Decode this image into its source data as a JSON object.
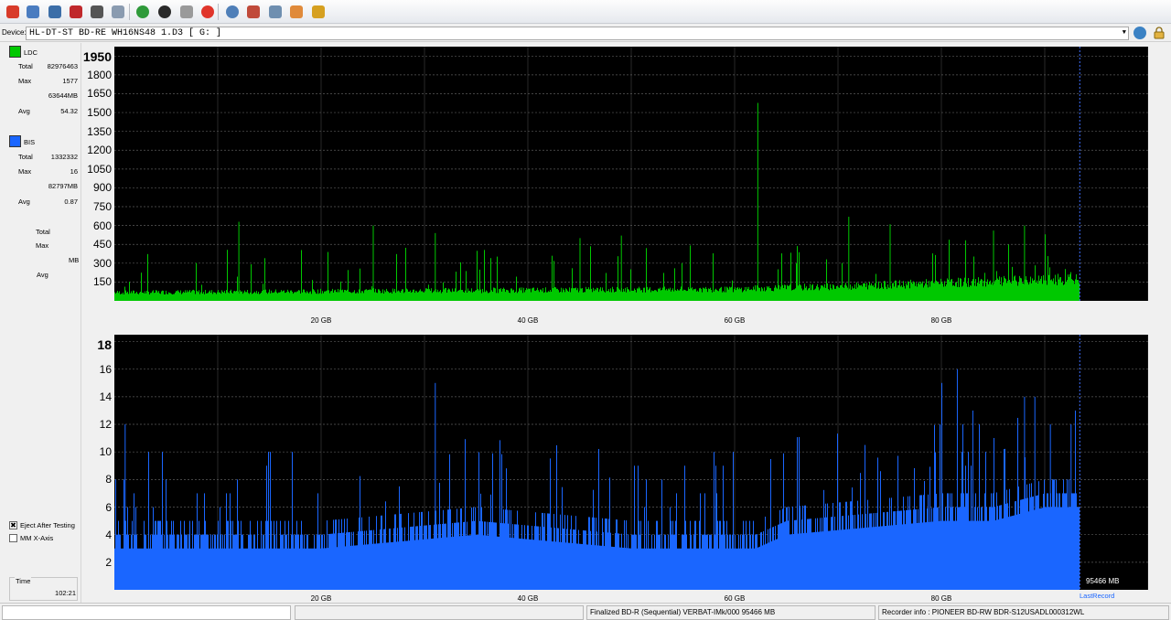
{
  "toolbar": {
    "buttons": [
      {
        "name": "power-button",
        "icon": "power-icon",
        "color": "#d83b2a"
      },
      {
        "name": "wizard-button",
        "icon": "wand-icon",
        "color": "#4a7cc0"
      },
      {
        "name": "scan-disc-button",
        "icon": "drive-icon",
        "color": "#3c6ea8"
      },
      {
        "name": "erase-button",
        "icon": "eraser-icon",
        "color": "#c0282b"
      },
      {
        "name": "burn-button",
        "icon": "disc-burn-icon",
        "color": "#555555"
      },
      {
        "name": "copy-button",
        "icon": "copy-icon",
        "color": "#8a9bb0"
      },
      {
        "name": "refresh-button",
        "icon": "refresh-icon",
        "color": "#2f9a3a"
      },
      {
        "name": "record-button",
        "icon": "record-icon",
        "color": "#2a2a2a"
      },
      {
        "name": "test-button",
        "icon": "check-disc-icon",
        "color": "#9a9a9a"
      },
      {
        "name": "stop-button",
        "icon": "stop-icon",
        "color": "#e0352b"
      },
      {
        "name": "info-button",
        "icon": "info-disc-icon",
        "color": "#4f7fb8"
      },
      {
        "name": "eject-button",
        "icon": "eject-icon",
        "color": "#c04a3a"
      },
      {
        "name": "save-button",
        "icon": "save-icon",
        "color": "#6f8fb0"
      },
      {
        "name": "palette-button",
        "icon": "palette-icon",
        "color": "#e08a3a"
      },
      {
        "name": "chart-button",
        "icon": "bar-chart-icon",
        "color": "#d6a020"
      }
    ]
  },
  "device": {
    "label": "Device:",
    "value": "HL-DT-ST BD-RE  WH16NS48  1.D3 [ G: ]"
  },
  "left_panel": {
    "ldc": {
      "legend": "LDC",
      "color": "#00c800",
      "total_label": "Total",
      "total": "82976463",
      "max_label": "Max",
      "max": "1577",
      "max_mb": "63644MB",
      "avg_label": "Avg",
      "avg": "54.32"
    },
    "bis": {
      "legend": "BIS",
      "color": "#1a66ff",
      "total_label": "Total",
      "total": "1332332",
      "max_label": "Max",
      "max": "16",
      "max_mb": "82797MB",
      "avg_label": "Avg",
      "avg": "0.87"
    },
    "third": {
      "total_label": "Total",
      "max_label": "Max",
      "mb_label": "MB",
      "avg_label": "Avg"
    },
    "eject_after_testing": {
      "label": "Eject After Testing",
      "checked": true
    },
    "mm_x_axis": {
      "label": "MM X-Axis",
      "checked": false
    },
    "time": {
      "label": "Time",
      "value": "102:21"
    }
  },
  "chart_data": [
    {
      "type": "area",
      "series": [
        {
          "name": "LDC",
          "color": "#00c800"
        }
      ],
      "y_ticks": [
        "1950",
        "1800",
        "1650",
        "1500",
        "1350",
        "1200",
        "1050",
        "900",
        "750",
        "600",
        "450",
        "300",
        "150"
      ],
      "ylim": [
        0,
        2025
      ],
      "x_ticks": [
        "20 GB",
        "40 GB",
        "60 GB",
        "80 GB"
      ],
      "x_tick_values": [
        20,
        40,
        60,
        80
      ],
      "xlim": [
        0,
        100
      ],
      "data_end_gb": 93.3,
      "baseline": [
        [
          0,
          70
        ],
        [
          10,
          75
        ],
        [
          20,
          80
        ],
        [
          30,
          85
        ],
        [
          40,
          90
        ],
        [
          50,
          95
        ],
        [
          60,
          95
        ],
        [
          62,
          105
        ],
        [
          70,
          120
        ],
        [
          80,
          150
        ],
        [
          90,
          175
        ],
        [
          93.3,
          180
        ]
      ],
      "spikes": [
        [
          12,
          630
        ],
        [
          25,
          600
        ],
        [
          31,
          540
        ],
        [
          45,
          500
        ],
        [
          49,
          520
        ],
        [
          62.2,
          1577
        ],
        [
          71,
          670
        ],
        [
          75,
          610
        ],
        [
          85,
          560
        ],
        [
          88,
          600
        ],
        [
          90,
          530
        ]
      ],
      "grid": true
    },
    {
      "type": "bar",
      "series": [
        {
          "name": "BIS",
          "color": "#1a66ff"
        }
      ],
      "y_ticks": [
        "18",
        "16",
        "14",
        "12",
        "10",
        "8",
        "6",
        "4",
        "2"
      ],
      "ylim": [
        0,
        18.5
      ],
      "x_ticks": [
        "20 GB",
        "40 GB",
        "60 GB",
        "80 GB"
      ],
      "x_tick_values": [
        20,
        40,
        60,
        80
      ],
      "xlim": [
        0,
        100
      ],
      "data_end_gb": 93.3,
      "baseline": [
        [
          0,
          4
        ],
        [
          20,
          4
        ],
        [
          35,
          5
        ],
        [
          50,
          4
        ],
        [
          62,
          4
        ],
        [
          65,
          5
        ],
        [
          80,
          6
        ],
        [
          85,
          6
        ],
        [
          90,
          7
        ],
        [
          93.3,
          7
        ]
      ],
      "spikes": [
        [
          1,
          12
        ],
        [
          31,
          15
        ],
        [
          80,
          15
        ],
        [
          81.5,
          16
        ],
        [
          83,
          13
        ],
        [
          88,
          14
        ],
        [
          89,
          14
        ],
        [
          90.5,
          12
        ],
        [
          92.5,
          12
        ]
      ],
      "end_label": "95466 MB",
      "last_record_label": "LastRecord",
      "grid": true
    }
  ],
  "status": {
    "progress": 0,
    "disc_info": "Finalized   BD-R (Sequential)   VERBAT-IMk/000   95466 MB",
    "recorder_info": "Recorder info : PIONEER        BD-RW   BDR-S12USADL000312WL"
  }
}
